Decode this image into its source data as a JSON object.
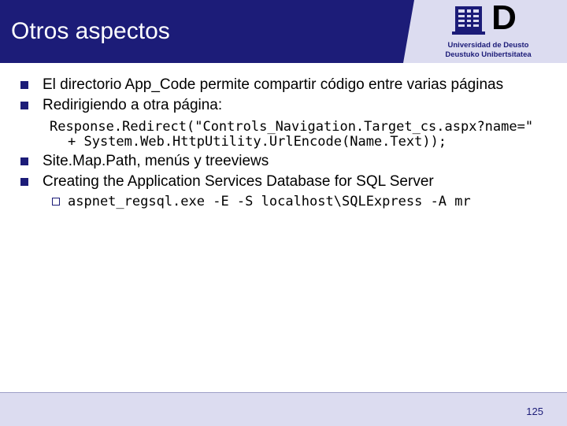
{
  "slide": {
    "title": "Otros aspectos",
    "page_number": "125"
  },
  "logo": {
    "letter": "D",
    "line1": "Universidad de Deusto",
    "line2": "Deustuko Unibertsitatea"
  },
  "bullets": [
    {
      "text": "El directorio App_Code permite compartir código entre varias páginas"
    },
    {
      "text": "Redirigiendo a otra página:"
    },
    {
      "text": "Site.Map.Path, menús y treeviews"
    },
    {
      "text": "Creating the Application Services Database for SQL Server"
    }
  ],
  "code": {
    "line1": "Response.Redirect(\"Controls_Navigation.Target_cs.aspx?name=\"",
    "line2": "+ System.Web.HttpUtility.UrlEncode(Name.Text));",
    "sub_command": "aspnet_regsql.exe -E -S localhost\\SQLExpress -A mr"
  },
  "colors": {
    "header": "#1c1c78",
    "logo_panel": "#dcdcf0",
    "footer": "#dcdcf0"
  }
}
